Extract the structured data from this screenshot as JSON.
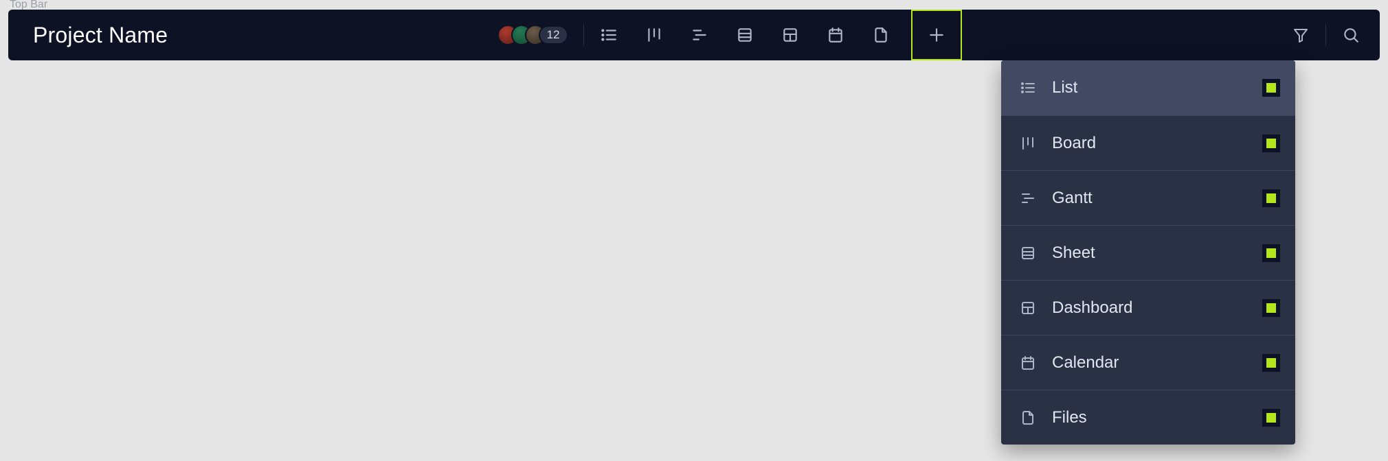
{
  "pageLabel": "Top Bar",
  "project": {
    "title": "Project Name"
  },
  "avatars": {
    "count": "12"
  },
  "views": {
    "items": [
      {
        "key": "list",
        "label": "List"
      },
      {
        "key": "board",
        "label": "Board"
      },
      {
        "key": "gantt",
        "label": "Gantt"
      },
      {
        "key": "sheet",
        "label": "Sheet"
      },
      {
        "key": "dashboard",
        "label": "Dashboard"
      },
      {
        "key": "calendar",
        "label": "Calendar"
      },
      {
        "key": "files",
        "label": "Files"
      }
    ]
  }
}
